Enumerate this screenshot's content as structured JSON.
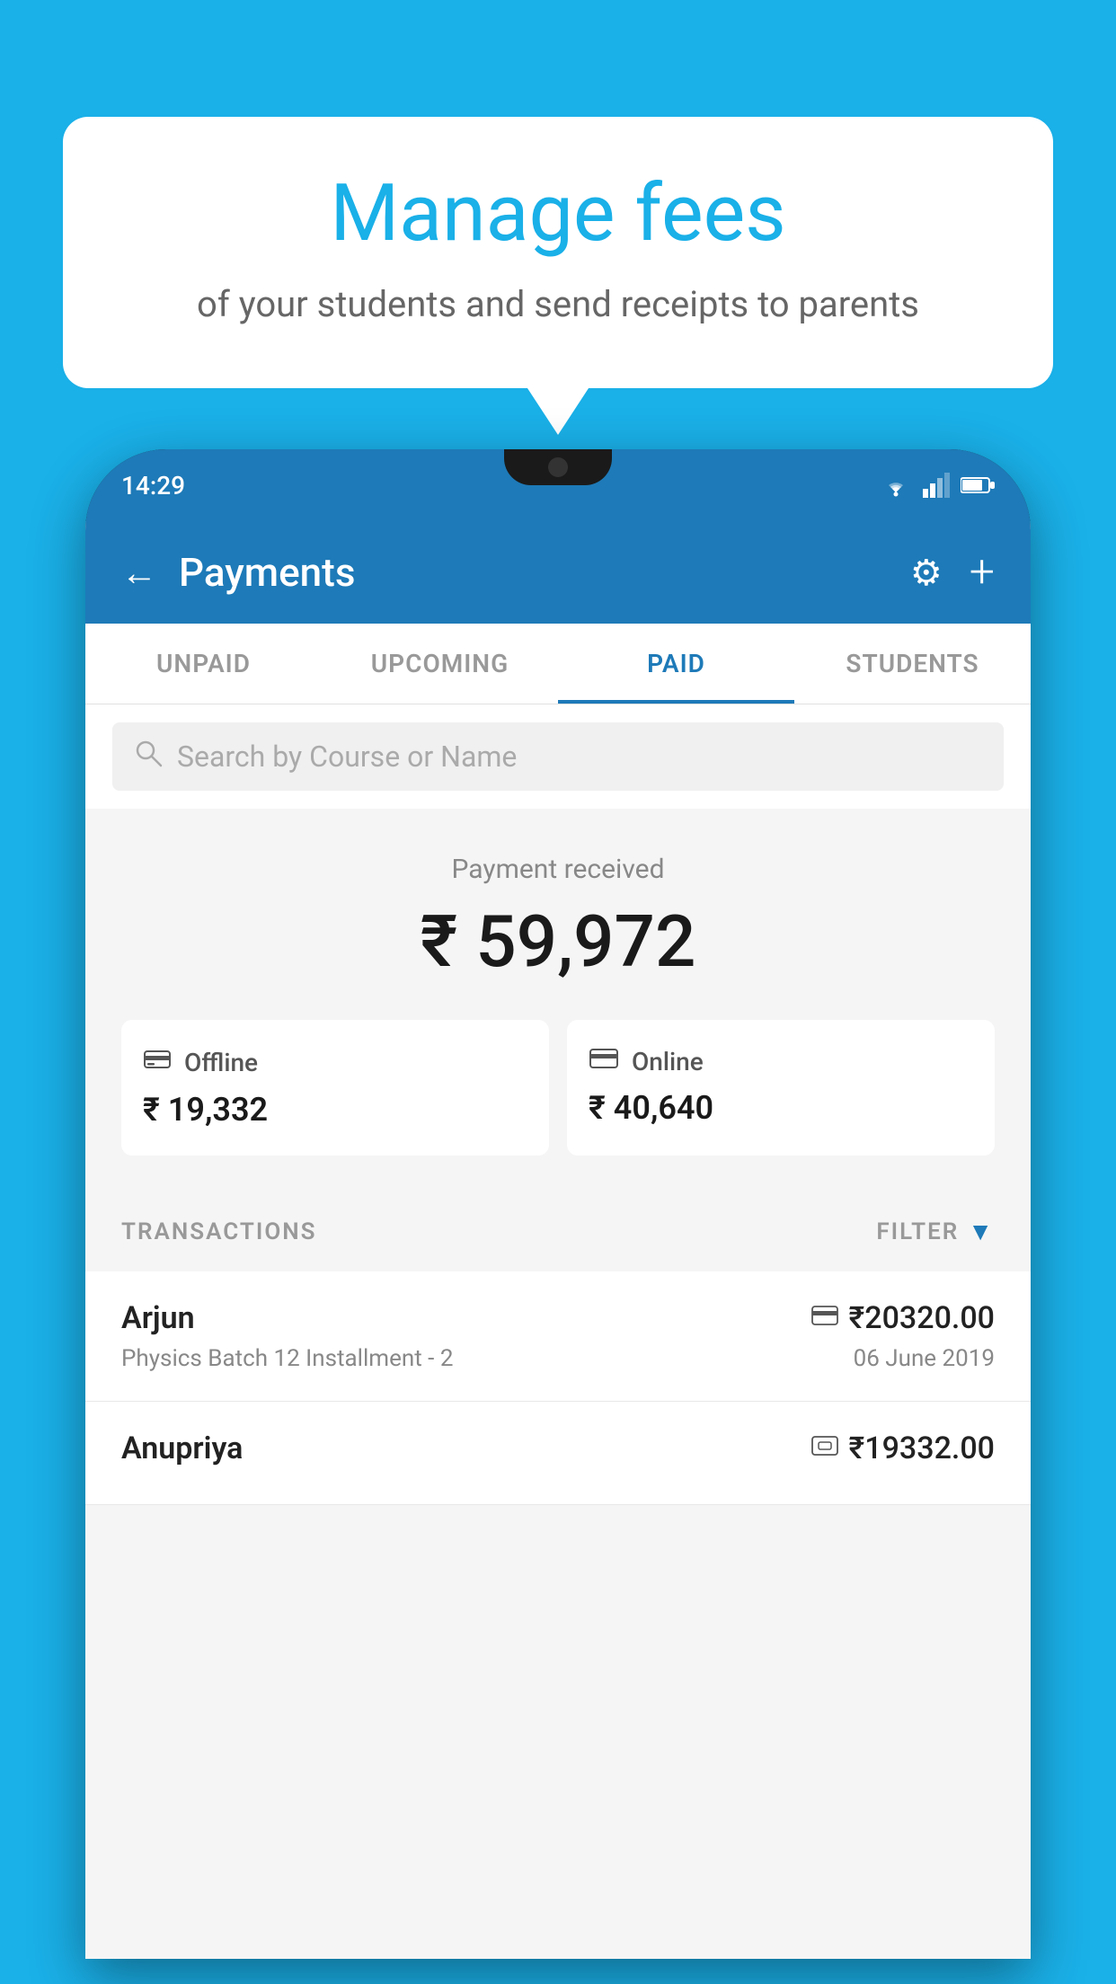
{
  "background_color": "#1ab0e8",
  "bubble": {
    "title": "Manage fees",
    "subtitle": "of your students and send receipts to parents"
  },
  "status_bar": {
    "time": "14:29"
  },
  "header": {
    "title": "Payments",
    "back_label": "←",
    "settings_label": "⚙",
    "add_label": "+"
  },
  "tabs": [
    {
      "label": "UNPAID",
      "active": false
    },
    {
      "label": "UPCOMING",
      "active": false
    },
    {
      "label": "PAID",
      "active": true
    },
    {
      "label": "STUDENTS",
      "active": false
    }
  ],
  "search": {
    "placeholder": "Search by Course or Name"
  },
  "payment_summary": {
    "label": "Payment received",
    "amount": "₹ 59,972",
    "offline": {
      "type": "Offline",
      "amount": "₹ 19,332"
    },
    "online": {
      "type": "Online",
      "amount": "₹ 40,640"
    }
  },
  "transactions": {
    "label": "TRANSACTIONS",
    "filter_label": "FILTER",
    "items": [
      {
        "name": "Arjun",
        "course": "Physics Batch 12 Installment - 2",
        "amount": "₹20320.00",
        "date": "06 June 2019",
        "method": "card"
      },
      {
        "name": "Anupriya",
        "course": "",
        "amount": "₹19332.00",
        "date": "",
        "method": "offline"
      }
    ]
  }
}
